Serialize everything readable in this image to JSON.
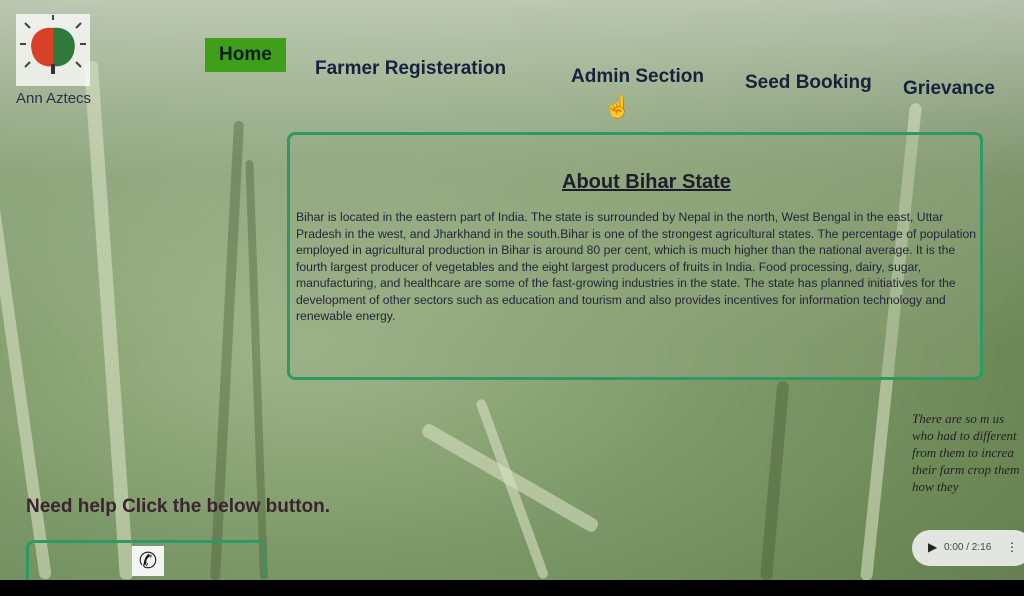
{
  "brand": {
    "name": "Ann Aztecs",
    "logo_icon": "brain-leaf-icon"
  },
  "nav": {
    "items": [
      {
        "label": "Home",
        "active": true
      },
      {
        "label": "Farmer Registeration",
        "active": false
      },
      {
        "label": "Admin Section",
        "active": false
      },
      {
        "label": "Seed Booking",
        "active": false
      },
      {
        "label": "Grievance",
        "active": false
      }
    ]
  },
  "about": {
    "title": "About Bihar State",
    "body": "Bihar is located in the eastern part of India. The state is surrounded by Nepal in the north, West Bengal in the east, Uttar Pradesh in the west, and Jharkhand in the south.Bihar is one of the strongest agricultural states. The percentage of population employed in agricultural production in Bihar is around 80 per cent, which is much higher than the national average. It is the fourth largest producer of vegetables and the eight largest producers of fruits in India. Food processing, dairy, sugar, manufacturing, and healthcare are some of the fast-growing industries in the state. The state has planned initiatives for the development of other sectors such as education and tourism and also provides incentives for information technology and renewable energy."
  },
  "help": {
    "text": "Need help Click the below button.",
    "icon": "phone-icon"
  },
  "testimonial": {
    "text": "There are so m us who had to different from them to increa their farm crop them how they",
    "audio_time": "0:00 / 2:16"
  },
  "colors": {
    "accent_green": "#3f9e1a",
    "border_green": "#2e9a63",
    "nav_text": "#16213d"
  }
}
